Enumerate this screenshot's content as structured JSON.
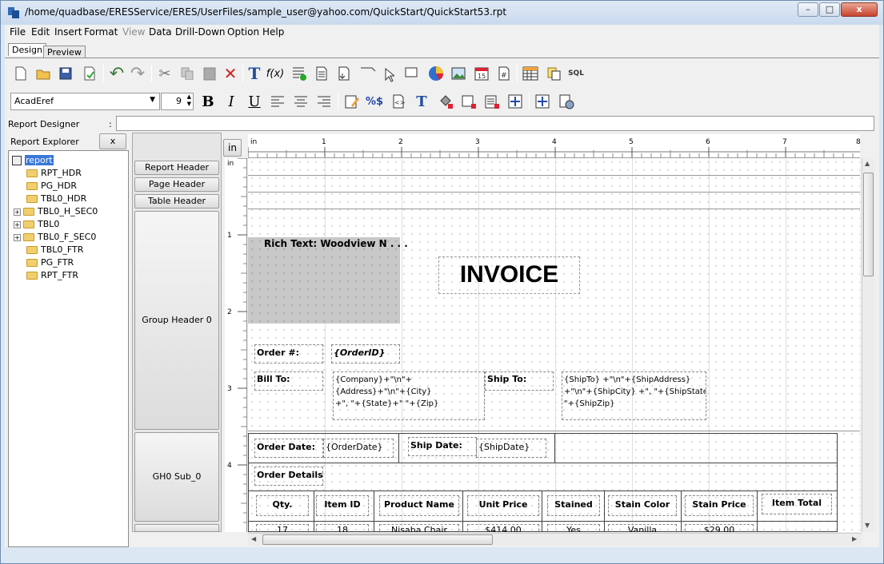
{
  "window": {
    "title": "/home/quadbase/ERESService/ERES/UserFiles/sample_user@yahoo.com/QuickStart/QuickStart53.rpt",
    "min": "–",
    "max": "□",
    "close": "x"
  },
  "menu": [
    "File",
    "Edit",
    "Insert",
    "Format",
    "View",
    "Data",
    "Drill-Down",
    "Option",
    "Help"
  ],
  "tabs": {
    "design": "Design",
    "preview": "Preview"
  },
  "format_bar": {
    "font": "AcadEref",
    "size": "9"
  },
  "designer": {
    "label": "Report Designer",
    "colon": ":",
    "value": ""
  },
  "explorer": {
    "title": "Report Explorer",
    "close": "x",
    "root": "report",
    "items": [
      "RPT_HDR",
      "PG_HDR",
      "TBL0_HDR",
      "TBL0_H_SEC0",
      "TBL0",
      "TBL0_F_SEC0",
      "TBL0_FTR",
      "PG_FTR",
      "RPT_FTR"
    ]
  },
  "unit_button": "in",
  "sections": {
    "report_header": "Report Header",
    "page_header": "Page Header",
    "table_header": "Table Header",
    "group_header": "Group Header 0",
    "gh0_sub": "GH0 Sub_0"
  },
  "ruler": {
    "h": [
      "in",
      "1",
      "2",
      "3",
      "4",
      "5",
      "6",
      "7",
      "8"
    ],
    "v": [
      "in",
      "1",
      "2",
      "3",
      "4"
    ]
  },
  "report": {
    "rich_text": "Rich Text: Woodview N . . .",
    "invoice": "INVOICE",
    "order_no_label": "Order #:",
    "order_id": "{OrderID}",
    "bill_to_label": "Bill To:",
    "bill_to_value_1": "{Company}+\"\\n\"+{Address}+\"\\n\"+{City}",
    "bill_to_value_2": "+\", \"+{State}+\" \"+{Zip}",
    "ship_to_label": "Ship To:",
    "ship_to_value_1": "{ShipTo} +\"\\n\"+{ShipAddress}",
    "ship_to_value_2": "+\"\\n\"+{ShipCity} +\", \"+{ShipState}+\"",
    "ship_to_value_3": "\"+{ShipZip}",
    "order_date_label": "Order Date:",
    "order_date": "{OrderDate}",
    "ship_date_label": "Ship Date:",
    "ship_date": "{ShipDate}",
    "order_details_label": "Order Details:",
    "columns": [
      "Qty.",
      "Item ID",
      "Product Name",
      "Unit Price",
      "Stained",
      "Stain Color",
      "Stain Price",
      "Item Total"
    ],
    "row": [
      "17",
      "18",
      "Nisaba Chair",
      "$414.00",
      "Yes",
      "Vanilla",
      "$29.00",
      ""
    ]
  }
}
